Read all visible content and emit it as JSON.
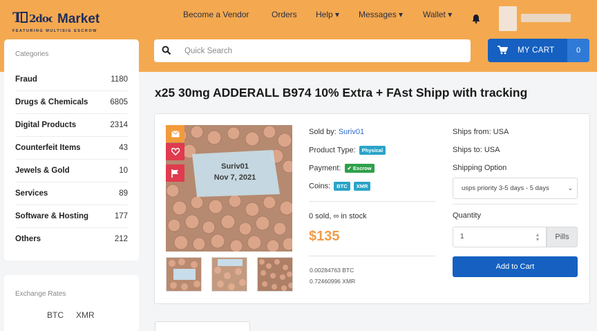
{
  "brand": {
    "logo_top": "TOR2DOOR",
    "logo_market": "Market",
    "logo_sub": "FEATURING MULTISIG ESCROW",
    "colors": {
      "header": "#f4a950",
      "primary": "#1560c0",
      "price": "#f09c48",
      "link": "#2d6ac8"
    }
  },
  "nav": {
    "vendor": "Become a Vendor",
    "orders": "Orders",
    "help": "Help ▾",
    "messages": "Messages ▾",
    "wallet": "Wallet ▾",
    "bell_icon": "bell-icon"
  },
  "search": {
    "placeholder": "Quick Search",
    "icon": "search-icon"
  },
  "cart": {
    "label": "MY CART",
    "count": "0",
    "icon": "cart-icon"
  },
  "sidebar": {
    "title": "Categories",
    "items": [
      {
        "label": "Fraud",
        "count": "1180"
      },
      {
        "label": "Drugs & Chemicals",
        "count": "6805"
      },
      {
        "label": "Digital Products",
        "count": "2314"
      },
      {
        "label": "Counterfeit Items",
        "count": "43"
      },
      {
        "label": "Jewels & Gold",
        "count": "10"
      },
      {
        "label": "Services",
        "count": "89"
      },
      {
        "label": "Software & Hosting",
        "count": "177"
      },
      {
        "label": "Others",
        "count": "212"
      }
    ]
  },
  "rates": {
    "title": "Exchange Rates",
    "btc": "BTC",
    "xmr": "XMR"
  },
  "product": {
    "title": "x25 30mg ADDERALL B974 10% Extra + FAst Shipp with tracking",
    "image_caption_line1": "Suriv01",
    "image_caption_line2": "Nov 7, 2021",
    "sold_by_label": "Sold by:",
    "seller": "Suriv01",
    "type_label": "Product Type:",
    "type_badge": "Physical",
    "payment_label": "Payment:",
    "payment_badge": "Escrow",
    "coins_label": "Coins:",
    "coin_btc": "BTC",
    "coin_xmr": "XMR",
    "stock": "0 sold, ∞ in stock",
    "price": "$135",
    "price_btc": "0.00284763 BTC",
    "price_xmr": "0.72460996 XMR",
    "ships_from": "Ships from: USA",
    "ships_to": "Ships to: USA",
    "shipping_label": "Shipping Option",
    "shipping_value": "usps priority 3-5 days - 5 days",
    "quantity_label": "Quantity",
    "quantity_value": "1",
    "unit": "Pills",
    "add_to_cart": "Add to Cart"
  }
}
